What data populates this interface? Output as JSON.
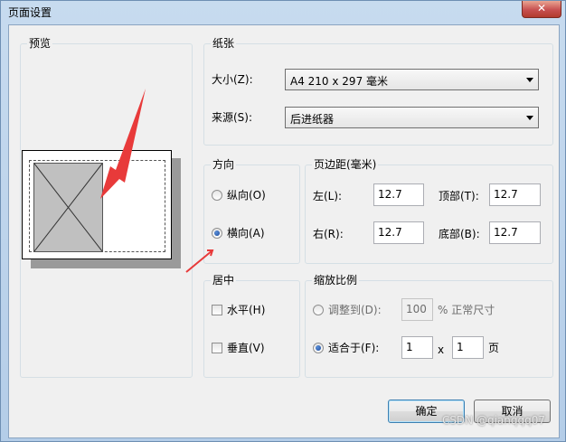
{
  "window": {
    "title": "页面设置",
    "close_glyph": "✕"
  },
  "preview": {
    "label": "预览"
  },
  "paper": {
    "label": "纸张",
    "size_label": "大小(Z):",
    "size_value": "A4 210 x 297 毫米",
    "source_label": "来源(S):",
    "source_value": "后进纸器"
  },
  "orientation": {
    "label": "方向",
    "portrait": "纵向(O)",
    "landscape": "横向(A)",
    "selected": "landscape"
  },
  "margins": {
    "label": "页边距(毫米)",
    "left_label": "左(L):",
    "left_value": "12.7",
    "top_label": "顶部(T):",
    "top_value": "12.7",
    "right_label": "右(R):",
    "right_value": "12.7",
    "bottom_label": "底部(B):",
    "bottom_value": "12.7"
  },
  "center": {
    "label": "居中",
    "horizontal": "水平(H)",
    "vertical": "垂直(V)"
  },
  "scale": {
    "label": "缩放比例",
    "adjust_label": "调整到(D):",
    "adjust_value": "100",
    "adjust_suffix": "% 正常尺寸",
    "fit_label": "适合于(F):",
    "fit_wide": "1",
    "fit_x": "x",
    "fit_tall": "1",
    "fit_suffix": "页"
  },
  "buttons": {
    "ok": "确定",
    "cancel": "取消"
  },
  "watermark": "CSDN @qianqqq07",
  "colors": {
    "annotation_arrow": "#e83a3a"
  }
}
